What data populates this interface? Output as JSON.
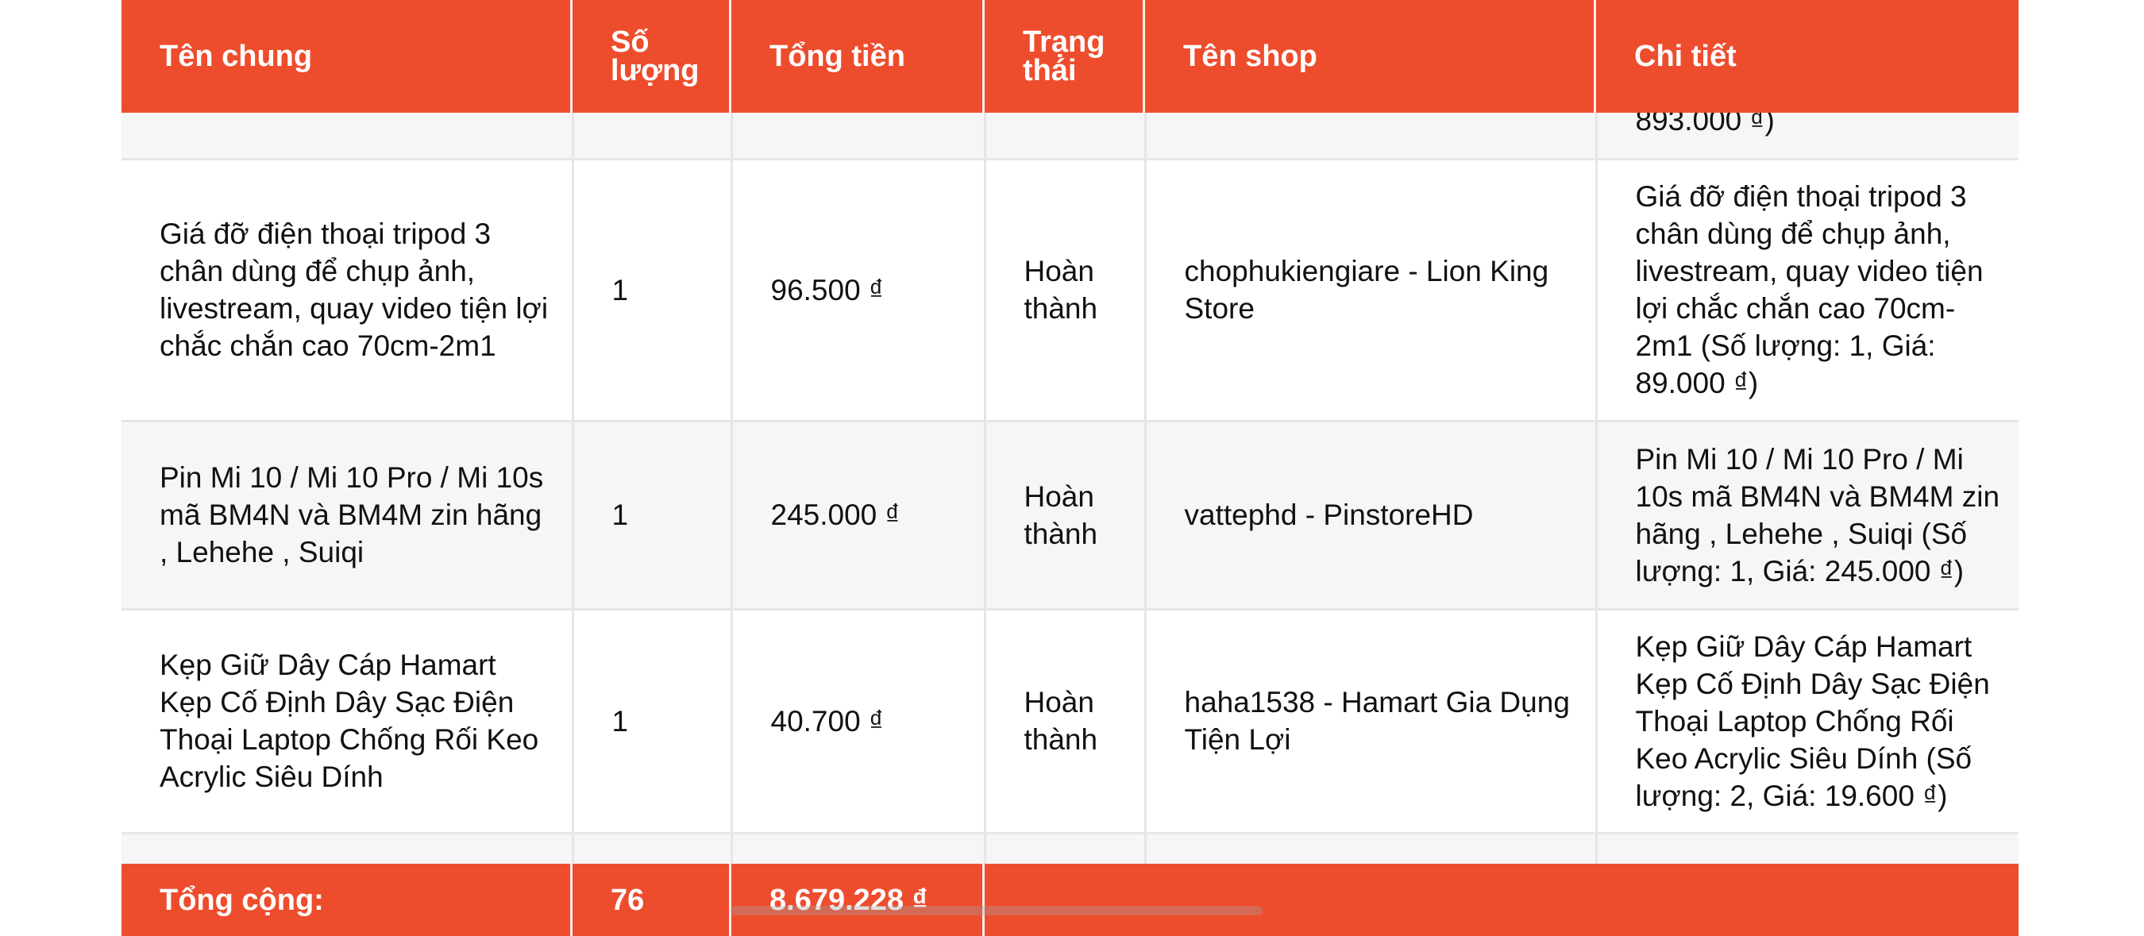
{
  "columns": [
    "Tên chung",
    "Số lượng",
    "Tổng tiền",
    "Trạng thái",
    "Tên shop",
    "Chi tiết"
  ],
  "partial_row": {
    "detail_tail": "893.000 ₫)"
  },
  "rows": [
    {
      "name": "Giá đỡ điện thoại tripod 3 chân dùng để chụp ảnh, livestream, quay video tiện lợi chắc chắn cao 70cm-2m1",
      "qty": "1",
      "total": "96.500 ₫",
      "status": "Hoàn thành",
      "shop": "chophukiengiare - Lion King Store",
      "detail": "Giá đỡ điện thoại tripod 3 chân dùng để chụp ảnh, livestream, quay video tiện lợi chắc chắn cao 70cm-2m1 (Số lượng: 1, Giá: 89.000 ₫)"
    },
    {
      "name": "Pin Mi 10 / Mi 10 Pro / Mi 10s mã BM4N và BM4M zin hãng , Lehehe , Suiqi",
      "qty": "1",
      "total": "245.000 ₫",
      "status": "Hoàn thành",
      "shop": "vattephd - PinstoreHD",
      "detail": "Pin Mi 10 / Mi 10 Pro / Mi 10s mã BM4N và BM4M zin hãng , Lehehe , Suiqi (Số lượng: 1, Giá: 245.000 ₫)"
    },
    {
      "name": "Kẹp Giữ Dây Cáp Hamart Kẹp Cố Định Dây Sạc Điện Thoại Laptop Chống Rối Keo Acrylic Siêu Dính",
      "qty": "1",
      "total": "40.700 ₫",
      "status": "Hoàn thành",
      "shop": "haha1538 - Hamart Gia Dụng Tiện Lợi",
      "detail": "Kẹp Giữ Dây Cáp Hamart Kẹp Cố Định Dây Sạc Điện Thoại Laptop Chống Rối Keo Acrylic Siêu Dính (Số lượng: 2, Giá: 19.600 ₫)"
    }
  ],
  "footer": {
    "label": "Tổng cộng:",
    "qty_total": "76",
    "amount_total": "8.679.228 ₫"
  },
  "colors": {
    "header_bg": "#ee4d2d",
    "header_text": "#ffffff",
    "row_alt": "#f6f6f6",
    "grid": "#e6e6e6"
  }
}
